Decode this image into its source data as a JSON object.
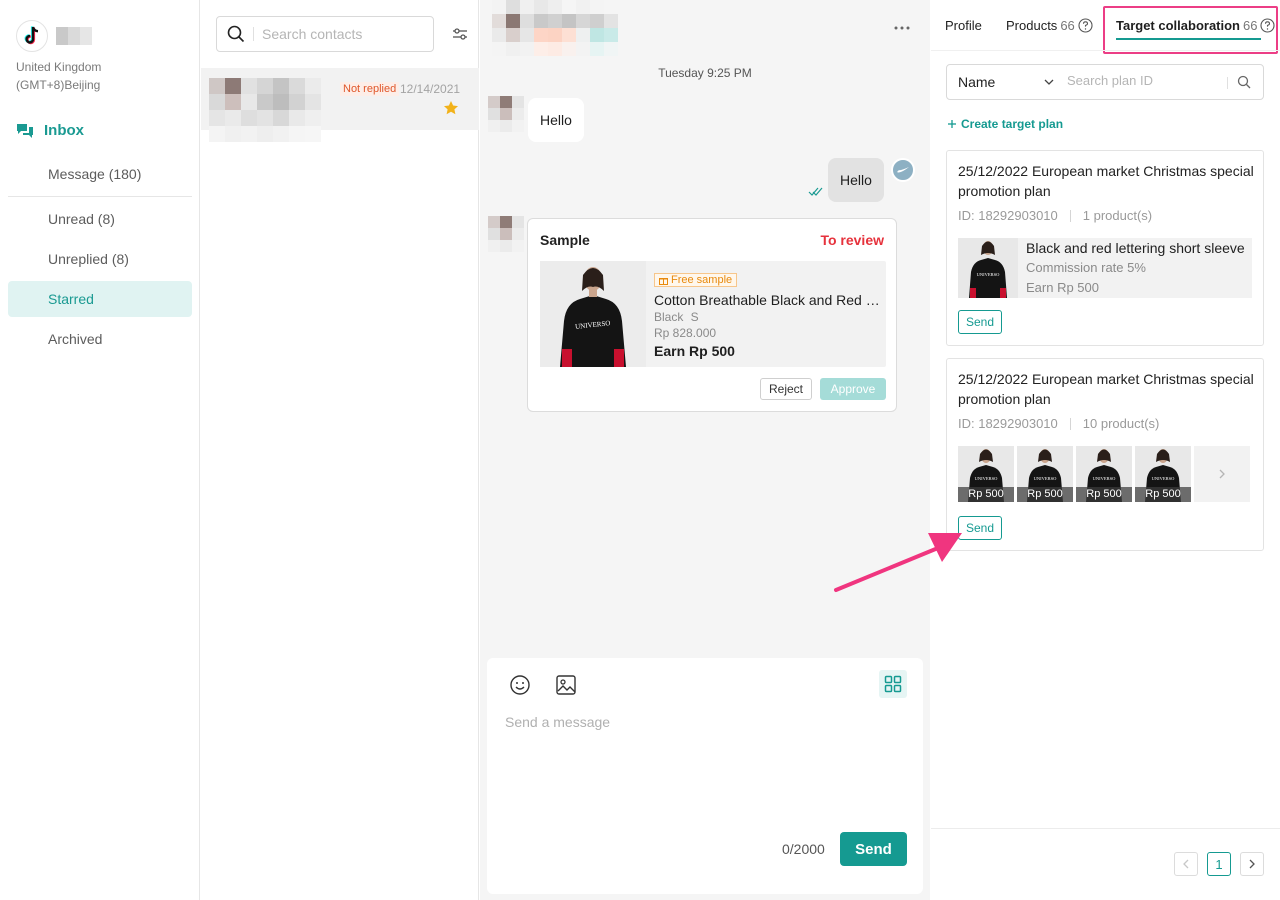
{
  "sidebar": {
    "region_line1": "United Kingdom",
    "region_line2": "(GMT+8)Beijing",
    "inbox_label": "Inbox",
    "items": [
      {
        "label": "Message (180)"
      },
      {
        "label": "Unread (8)"
      },
      {
        "label": "Unreplied  (8)"
      },
      {
        "label": "Starred",
        "active": true
      },
      {
        "label": "Archived"
      }
    ]
  },
  "contacts": {
    "search_placeholder": "Search contacts",
    "rows": [
      {
        "status": "Not replied",
        "date": "12/14/2021",
        "starred": true
      }
    ]
  },
  "chat": {
    "time_label": "Tuesday  9:25 PM",
    "messages": [
      {
        "from": "contact",
        "text": "Hello"
      },
      {
        "from": "me",
        "text": "Hello"
      }
    ],
    "sample_card": {
      "title": "Sample",
      "status": "To review",
      "free_tag": "Free sample",
      "product_name": "Cotton Breathable Black and Red lettering short sleeve",
      "variant": "Black  S",
      "price": "Rp 828.000",
      "earn": "Earn Rp 500",
      "reject_label": "Reject",
      "approve_label": "Approve"
    },
    "composer": {
      "placeholder": "Send a message",
      "char_count": "0/2000",
      "send_label": "Send"
    }
  },
  "right_panel": {
    "tabs": [
      {
        "label": "Profile"
      },
      {
        "label": "Products",
        "count": "66"
      },
      {
        "label": "Target collaboration",
        "count": "66",
        "active": true
      }
    ],
    "filter_select": "Name",
    "search_placeholder": "Search plan ID",
    "create_label": "Create target plan",
    "plans": [
      {
        "title": "25/12/2022 European market Christmas special promotion plan",
        "id_label": "ID: 18292903010",
        "count_label": "1 product(s)",
        "product": {
          "name": "Black and red lettering short sleeve",
          "commission": "Commission rate 5%",
          "earn": "Earn Rp 500"
        },
        "send_label": "Send"
      },
      {
        "title": "25/12/2022 European market Christmas special promotion plan",
        "id_label": "ID: 18292903010",
        "count_label": "10 product(s)",
        "thumb_prices": [
          "Rp 500",
          "Rp 500",
          "Rp 500",
          "Rp 500"
        ],
        "send_label": "Send"
      }
    ],
    "pagination": {
      "current": "1"
    }
  },
  "colors": {
    "accent": "#159a91",
    "accent_light": "#e0f3f2",
    "alert_red": "#e6323c",
    "highlight_pink": "#ec3e86"
  }
}
